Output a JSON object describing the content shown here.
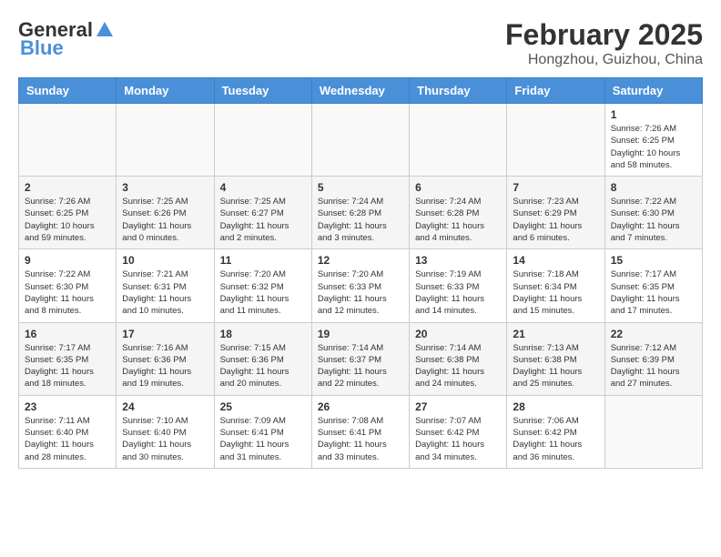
{
  "header": {
    "logo_general": "General",
    "logo_blue": "Blue",
    "month_year": "February 2025",
    "location": "Hongzhou, Guizhou, China"
  },
  "weekdays": [
    "Sunday",
    "Monday",
    "Tuesday",
    "Wednesday",
    "Thursday",
    "Friday",
    "Saturday"
  ],
  "weeks": [
    [
      {
        "day": "",
        "detail": ""
      },
      {
        "day": "",
        "detail": ""
      },
      {
        "day": "",
        "detail": ""
      },
      {
        "day": "",
        "detail": ""
      },
      {
        "day": "",
        "detail": ""
      },
      {
        "day": "",
        "detail": ""
      },
      {
        "day": "1",
        "detail": "Sunrise: 7:26 AM\nSunset: 6:25 PM\nDaylight: 10 hours\nand 58 minutes."
      }
    ],
    [
      {
        "day": "2",
        "detail": "Sunrise: 7:26 AM\nSunset: 6:25 PM\nDaylight: 10 hours\nand 59 minutes."
      },
      {
        "day": "3",
        "detail": "Sunrise: 7:25 AM\nSunset: 6:26 PM\nDaylight: 11 hours\nand 0 minutes."
      },
      {
        "day": "4",
        "detail": "Sunrise: 7:25 AM\nSunset: 6:27 PM\nDaylight: 11 hours\nand 2 minutes."
      },
      {
        "day": "5",
        "detail": "Sunrise: 7:24 AM\nSunset: 6:28 PM\nDaylight: 11 hours\nand 3 minutes."
      },
      {
        "day": "6",
        "detail": "Sunrise: 7:24 AM\nSunset: 6:28 PM\nDaylight: 11 hours\nand 4 minutes."
      },
      {
        "day": "7",
        "detail": "Sunrise: 7:23 AM\nSunset: 6:29 PM\nDaylight: 11 hours\nand 6 minutes."
      },
      {
        "day": "8",
        "detail": "Sunrise: 7:22 AM\nSunset: 6:30 PM\nDaylight: 11 hours\nand 7 minutes."
      }
    ],
    [
      {
        "day": "9",
        "detail": "Sunrise: 7:22 AM\nSunset: 6:30 PM\nDaylight: 11 hours\nand 8 minutes."
      },
      {
        "day": "10",
        "detail": "Sunrise: 7:21 AM\nSunset: 6:31 PM\nDaylight: 11 hours\nand 10 minutes."
      },
      {
        "day": "11",
        "detail": "Sunrise: 7:20 AM\nSunset: 6:32 PM\nDaylight: 11 hours\nand 11 minutes."
      },
      {
        "day": "12",
        "detail": "Sunrise: 7:20 AM\nSunset: 6:33 PM\nDaylight: 11 hours\nand 12 minutes."
      },
      {
        "day": "13",
        "detail": "Sunrise: 7:19 AM\nSunset: 6:33 PM\nDaylight: 11 hours\nand 14 minutes."
      },
      {
        "day": "14",
        "detail": "Sunrise: 7:18 AM\nSunset: 6:34 PM\nDaylight: 11 hours\nand 15 minutes."
      },
      {
        "day": "15",
        "detail": "Sunrise: 7:17 AM\nSunset: 6:35 PM\nDaylight: 11 hours\nand 17 minutes."
      }
    ],
    [
      {
        "day": "16",
        "detail": "Sunrise: 7:17 AM\nSunset: 6:35 PM\nDaylight: 11 hours\nand 18 minutes."
      },
      {
        "day": "17",
        "detail": "Sunrise: 7:16 AM\nSunset: 6:36 PM\nDaylight: 11 hours\nand 19 minutes."
      },
      {
        "day": "18",
        "detail": "Sunrise: 7:15 AM\nSunset: 6:36 PM\nDaylight: 11 hours\nand 20 minutes."
      },
      {
        "day": "19",
        "detail": "Sunrise: 7:14 AM\nSunset: 6:37 PM\nDaylight: 11 hours\nand 22 minutes."
      },
      {
        "day": "20",
        "detail": "Sunrise: 7:14 AM\nSunset: 6:38 PM\nDaylight: 11 hours\nand 24 minutes."
      },
      {
        "day": "21",
        "detail": "Sunrise: 7:13 AM\nSunset: 6:38 PM\nDaylight: 11 hours\nand 25 minutes."
      },
      {
        "day": "22",
        "detail": "Sunrise: 7:12 AM\nSunset: 6:39 PM\nDaylight: 11 hours\nand 27 minutes."
      }
    ],
    [
      {
        "day": "23",
        "detail": "Sunrise: 7:11 AM\nSunset: 6:40 PM\nDaylight: 11 hours\nand 28 minutes."
      },
      {
        "day": "24",
        "detail": "Sunrise: 7:10 AM\nSunset: 6:40 PM\nDaylight: 11 hours\nand 30 minutes."
      },
      {
        "day": "25",
        "detail": "Sunrise: 7:09 AM\nSunset: 6:41 PM\nDaylight: 11 hours\nand 31 minutes."
      },
      {
        "day": "26",
        "detail": "Sunrise: 7:08 AM\nSunset: 6:41 PM\nDaylight: 11 hours\nand 33 minutes."
      },
      {
        "day": "27",
        "detail": "Sunrise: 7:07 AM\nSunset: 6:42 PM\nDaylight: 11 hours\nand 34 minutes."
      },
      {
        "day": "28",
        "detail": "Sunrise: 7:06 AM\nSunset: 6:42 PM\nDaylight: 11 hours\nand 36 minutes."
      },
      {
        "day": "",
        "detail": ""
      }
    ]
  ]
}
